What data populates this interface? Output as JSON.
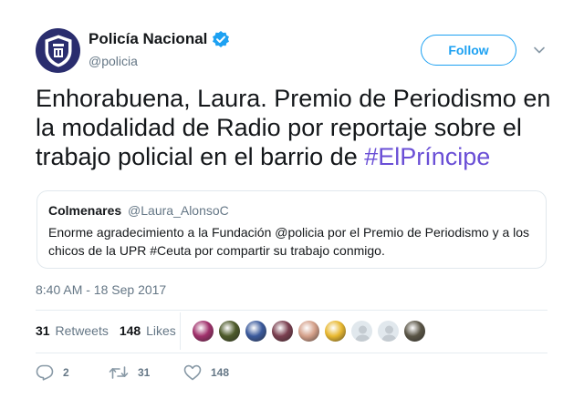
{
  "author": {
    "display_name": "Policía Nacional",
    "handle": "@policia",
    "verified": true,
    "avatar_icon": "police-shield-emblem",
    "brand_color": "#2a2d6e"
  },
  "follow_button": {
    "label": "Follow",
    "color": "#1da1f2"
  },
  "more_menu_icon": "chevron-down-icon",
  "tweet": {
    "text": "Enhorabuena, Laura. Premio de Periodismo en la modalidad de Radio por reportaje sobre el trabajo policial en el barrio de ",
    "hashtag": "#ElPríncipe",
    "hashtag_color": "#6a4fd6"
  },
  "quoted_tweet": {
    "author_name": "Colmenares",
    "author_handle": "@Laura_AlonsoC",
    "text": "Enorme agradecimiento a la Fundación @policia por el Premio de Periodismo y a los chicos de la UPR #Ceuta por compartir su trabajo conmigo."
  },
  "timestamp": "8:40 AM - 18 Sep 2017",
  "stats": {
    "retweets_count": "31",
    "retweets_label": "Retweets",
    "likes_count": "148",
    "likes_label": "Likes"
  },
  "likers": [
    {
      "icon": "avatar-1",
      "color": "#a0306b"
    },
    {
      "icon": "avatar-2",
      "color": "#4d5a2a"
    },
    {
      "icon": "avatar-3",
      "color": "#3b5a9c"
    },
    {
      "icon": "avatar-4",
      "color": "#7a3f4f"
    },
    {
      "icon": "avatar-5",
      "color": "#d4a08a"
    },
    {
      "icon": "avatar-6",
      "color": "#e8b830"
    },
    {
      "icon": "default-avatar",
      "color": "#c4cbd1"
    },
    {
      "icon": "default-avatar",
      "color": "#c4cbd1"
    },
    {
      "icon": "avatar-9",
      "color": "#5a5546"
    }
  ],
  "actions": {
    "reply_count": "2",
    "retweet_count": "31",
    "like_count": "148"
  }
}
